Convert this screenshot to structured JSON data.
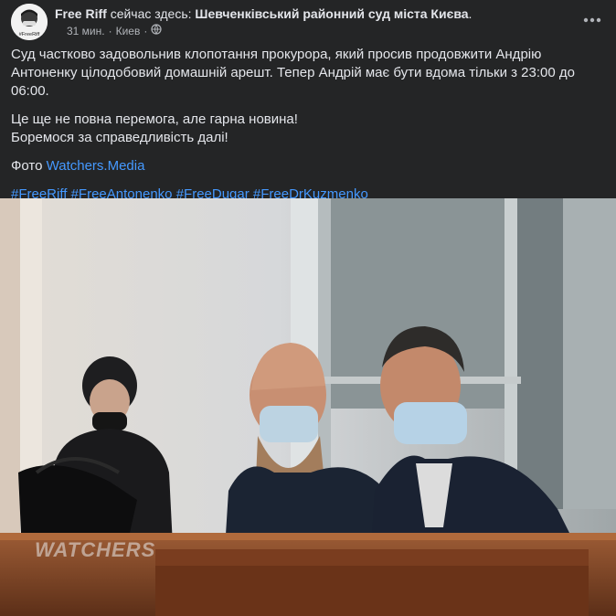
{
  "post": {
    "author": "Free Riff",
    "verb": "сейчас здесь:",
    "place": "Шевченківський районний суд міста Києва",
    "place_suffix": ".",
    "time": "31 мин.",
    "separator": "·",
    "location": "Киев",
    "separator2": "·",
    "avatar_text": "#FreeRiff",
    "paragraph1": "Суд частково задовольнив клопотання прокурора, який просив продовжити Андрію Антоненку цілодобовий домашній арешт. Тепер Андрій має бути вдома тільки з 23:00 до 06:00.",
    "paragraph2_line1": "Це ще не повна перемога, але гарна новина!",
    "paragraph2_line2": "Боремося за справедливість далі!",
    "photo_label": "Фото",
    "photo_link": "Watchers.Media",
    "hashtags": [
      "#FreeRiff",
      "#FreeAntonenko",
      "#FreeDugar",
      "#FreeDrKuzmenko"
    ],
    "watermark": "WATCHERS"
  },
  "colors": {
    "background": "#242526",
    "text": "#e4e6eb",
    "secondary_text": "#b0b3b8",
    "link": "#4599ff"
  },
  "icons": {
    "privacy": "globe-icon",
    "more": "more-options-icon"
  }
}
